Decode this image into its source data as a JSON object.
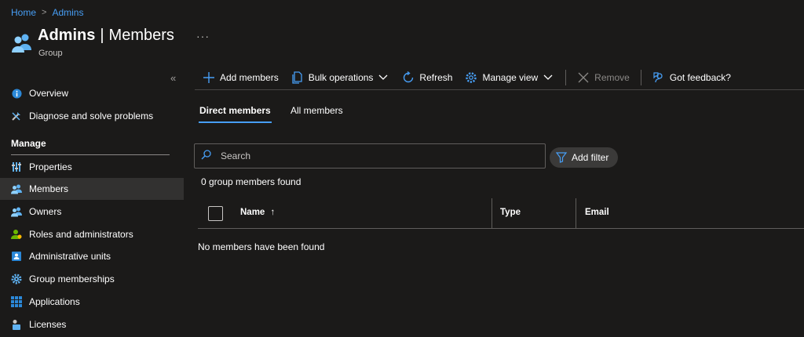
{
  "breadcrumb": {
    "home": "Home",
    "separator": ">",
    "current": "Admins"
  },
  "header": {
    "title_name": "Admins",
    "title_bar": "|",
    "title_section": "Members",
    "more": "···",
    "subtitle": "Group"
  },
  "sidebar": {
    "collapse": "«",
    "top_items": [
      {
        "label": "Overview",
        "icon": "info-icon"
      },
      {
        "label": "Diagnose and solve problems",
        "icon": "wrench-icon"
      }
    ],
    "manage_header": "Manage",
    "manage_items": [
      {
        "label": "Properties",
        "icon": "properties-icon"
      },
      {
        "label": "Members",
        "icon": "members-icon",
        "active": true
      },
      {
        "label": "Owners",
        "icon": "owners-icon"
      },
      {
        "label": "Roles and administrators",
        "icon": "roles-icon"
      },
      {
        "label": "Administrative units",
        "icon": "admin-units-icon"
      },
      {
        "label": "Group memberships",
        "icon": "gear-icon"
      },
      {
        "label": "Applications",
        "icon": "apps-grid-icon"
      },
      {
        "label": "Licenses",
        "icon": "licenses-icon"
      }
    ]
  },
  "toolbar": {
    "add_members": "Add members",
    "bulk_operations": "Bulk operations",
    "refresh": "Refresh",
    "manage_view": "Manage view",
    "remove": "Remove",
    "feedback": "Got feedback?"
  },
  "tabs": {
    "direct": "Direct members",
    "all": "All members"
  },
  "search": {
    "placeholder": "Search"
  },
  "filter": {
    "label": "Add filter"
  },
  "status": {
    "count": "0 group members found",
    "empty": "No members have been found"
  },
  "table": {
    "columns": {
      "name": "Name",
      "sort_indicator": "↑",
      "type": "Type",
      "email": "Email"
    }
  },
  "colors": {
    "accent": "#479ef5",
    "background": "#1b1a19",
    "active_item": "#323130"
  }
}
